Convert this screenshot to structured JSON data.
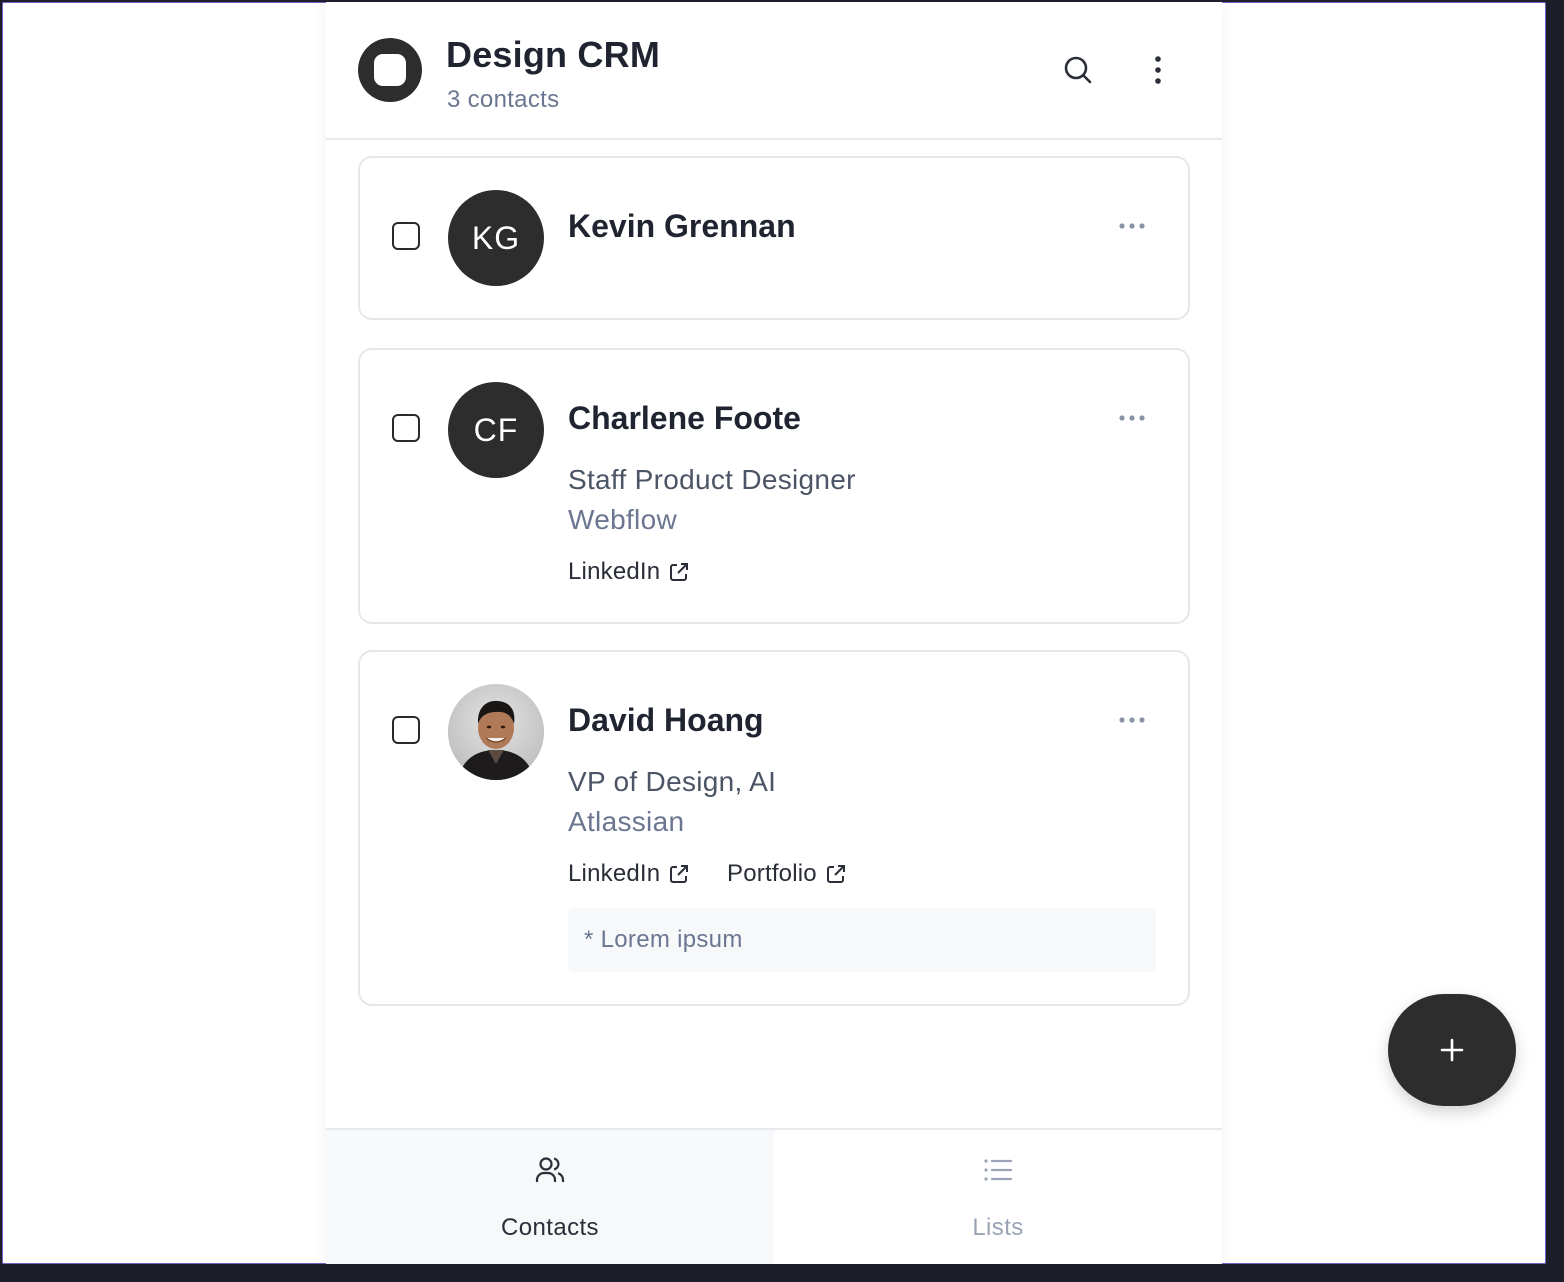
{
  "app": {
    "title": "Design CRM",
    "subtitle": "3 contacts",
    "logo_icon": "app-logo-icon",
    "header_actions": [
      "search-icon",
      "more-vertical-icon"
    ]
  },
  "contacts": [
    {
      "initials": "KG",
      "name": "Kevin Grennan",
      "role": "",
      "company": "",
      "links": [],
      "note": ""
    },
    {
      "initials": "CF",
      "name": "Charlene Foote",
      "role": "Staff Product Designer",
      "company": "Webflow",
      "links": [
        "LinkedIn"
      ],
      "note": ""
    },
    {
      "initials": "",
      "avatar": "photo",
      "name": "David Hoang",
      "role": "VP of Design, AI",
      "company": "Atlassian",
      "links": [
        "LinkedIn",
        "Portfolio"
      ],
      "note": "* Lorem ipsum"
    }
  ],
  "tabs": [
    {
      "label": "Contacts",
      "icon": "users-icon",
      "active": true
    },
    {
      "label": "Lists",
      "icon": "list-icon",
      "active": false
    }
  ],
  "fab": {
    "icon": "plus-icon"
  },
  "colors": {
    "accent": "#2d2d2d",
    "text": "#1f2430",
    "muted": "#6b7690",
    "border": "#e5e7eb",
    "inactive_tab": "#9aa3b5"
  }
}
